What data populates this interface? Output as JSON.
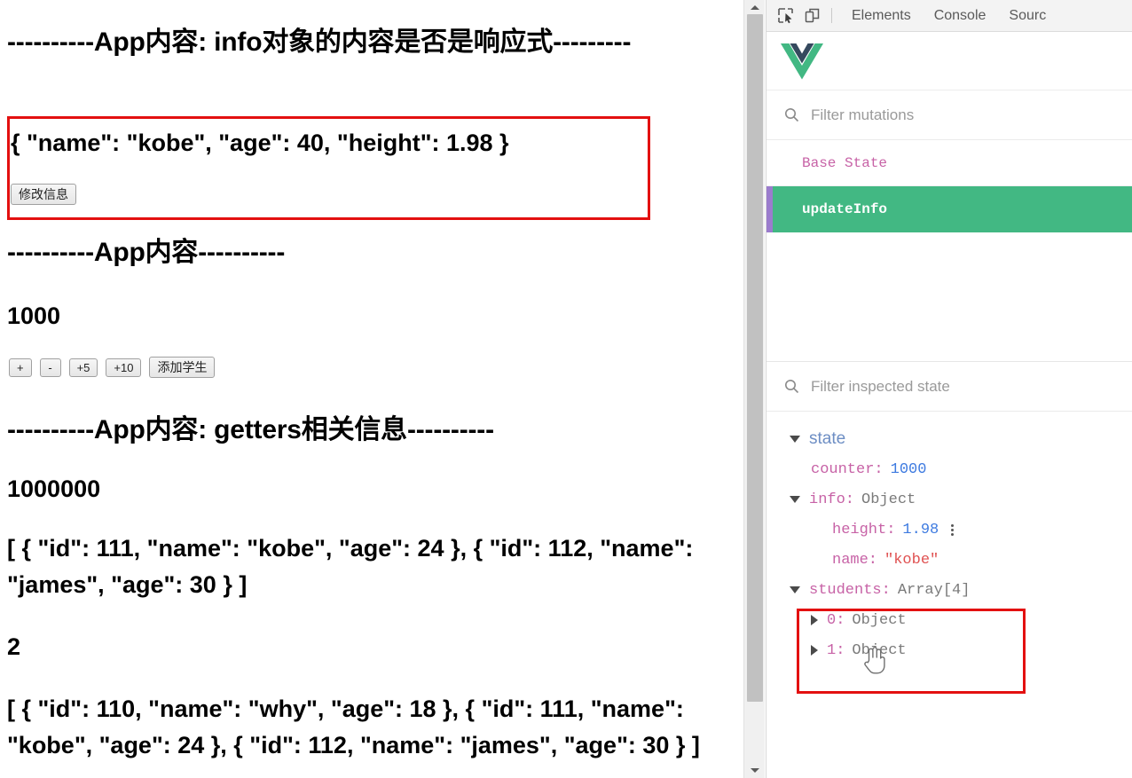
{
  "page": {
    "heading_info": "----------App内容: info对象的内容是否是响应式---------",
    "info_json": "{ \"name\": \"kobe\", \"age\": 40, \"height\": 1.98 }",
    "modify_button": "修改信息",
    "heading_app": "----------App内容----------",
    "counter_value": "1000",
    "buttons": [
      {
        "name": "increment-button",
        "label": "+"
      },
      {
        "name": "decrement-button",
        "label": "-"
      },
      {
        "name": "add-five-button",
        "label": "+5"
      },
      {
        "name": "add-ten-button",
        "label": "+10"
      },
      {
        "name": "add-student-button",
        "label": "添加学生"
      }
    ],
    "heading_getters": "----------App内容: getters相关信息----------",
    "getter_big_number": "1000000",
    "getter_list_1": "[ { \"id\": 111, \"name\": \"kobe\", \"age\": 24 }, { \"id\": 112, \"name\": \"james\", \"age\": 30 } ]",
    "getter_count": "2",
    "getter_list_2": "[ { \"id\": 110, \"name\": \"why\", \"age\": 18 }, { \"id\": 111, \"name\": \"kobe\", \"age\": 24 }, { \"id\": 112, \"name\": \"james\", \"age\": 30 } ]"
  },
  "devtools": {
    "tabs": [
      "Elements",
      "Console",
      "Sourc"
    ],
    "icons": {
      "inspect": "inspect-element-icon",
      "device": "device-toolbar-icon"
    },
    "logo": "vue-logo",
    "mutations": {
      "filter_placeholder": "Filter mutations",
      "rows": [
        {
          "label": "Base State",
          "active": false
        },
        {
          "label": "updateInfo",
          "active": true
        }
      ]
    },
    "inspected": {
      "filter_placeholder": "Filter inspected state",
      "root_label": "state",
      "counter_key": "counter:",
      "counter_value": "1000",
      "info_key": "info:",
      "info_type": "Object",
      "height_key": "height:",
      "height_value": "1.98",
      "name_key": "name:",
      "name_value": "\"kobe\"",
      "students_key": "students:",
      "students_type": "Array[4]",
      "child0_key": "0:",
      "child0_type": "Object",
      "child1_key": "1:",
      "child1_type": "Object"
    }
  },
  "colors": {
    "vue_green": "#42b883",
    "vue_navy": "#35495e",
    "highlight_purple": "#9b7ccd",
    "annotation_red": "#e31010"
  }
}
